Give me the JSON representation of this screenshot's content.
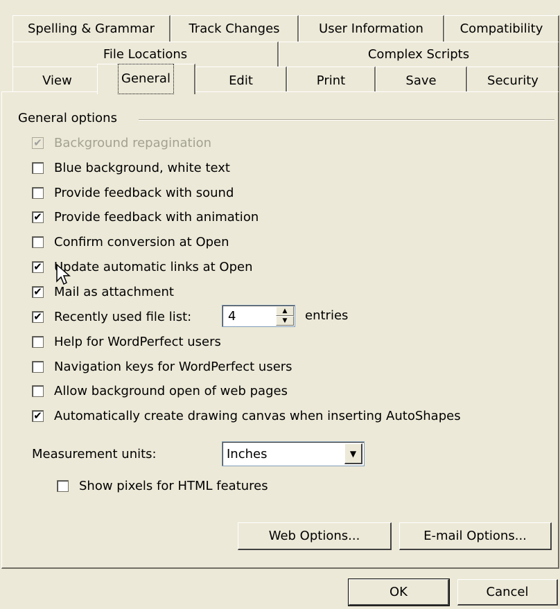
{
  "tabs": {
    "row1": [
      "Spelling & Grammar",
      "Track Changes",
      "User Information",
      "Compatibility"
    ],
    "row2": [
      "File Locations",
      "Complex Scripts"
    ],
    "row3": [
      "View",
      "General",
      "Edit",
      "Print",
      "Save",
      "Security"
    ],
    "selected": "General"
  },
  "group_title": "General options",
  "options": [
    {
      "label": "Background repagination",
      "checked": true,
      "disabled": true
    },
    {
      "label": "Blue background, white text",
      "checked": false
    },
    {
      "label": "Provide feedback with sound",
      "checked": false
    },
    {
      "label": "Provide feedback with animation",
      "checked": true
    },
    {
      "label": "Confirm conversion at Open",
      "checked": false
    },
    {
      "label": "Update automatic links at Open",
      "checked": true
    },
    {
      "label": "Mail as attachment",
      "checked": true
    },
    {
      "label": "Recently used file list:",
      "checked": true
    },
    {
      "label": "Help for WordPerfect users",
      "checked": false
    },
    {
      "label": "Navigation keys for WordPerfect users",
      "checked": false
    },
    {
      "label": "Allow background open of web pages",
      "checked": false
    },
    {
      "label": "Automatically create drawing canvas when inserting AutoShapes",
      "checked": true
    }
  ],
  "recent_files": {
    "value": "4",
    "suffix": "entries"
  },
  "measurement": {
    "label": "Measurement units:",
    "value": "Inches"
  },
  "show_pixels": {
    "label": "Show pixels for HTML features",
    "checked": false
  },
  "buttons": {
    "web_options": "Web Options...",
    "email_options": "E-mail Options...",
    "ok": "OK",
    "cancel": "Cancel"
  }
}
